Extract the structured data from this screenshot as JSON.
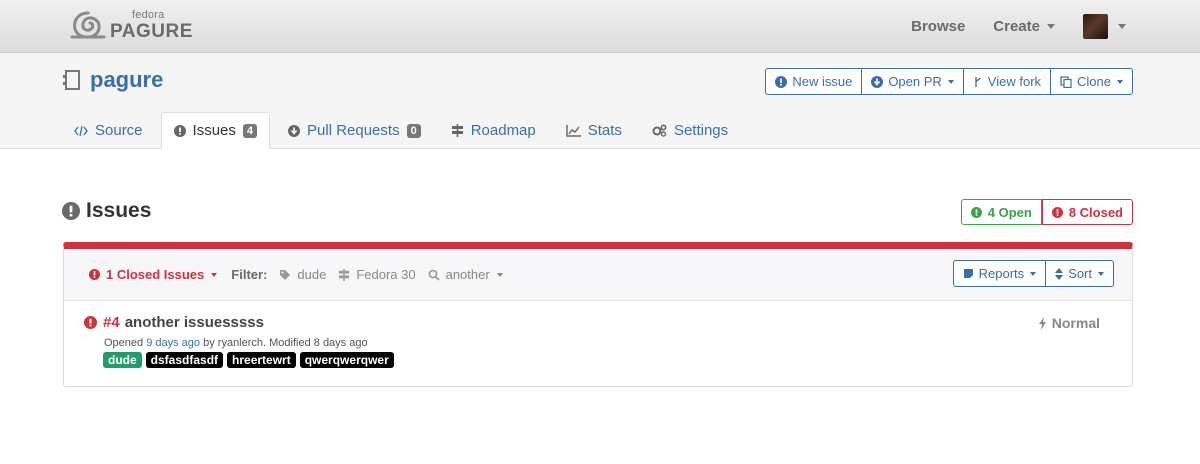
{
  "navbar": {
    "logo_small": "fedora",
    "logo_big": "PAGURE",
    "browse": "Browse",
    "create": "Create"
  },
  "repo": {
    "name": "pagure",
    "buttons": {
      "new_issue": "New issue",
      "open_pr": "Open PR",
      "view_fork": "View fork",
      "clone": "Clone"
    },
    "tabs": [
      {
        "label": "Source"
      },
      {
        "label": "Issues",
        "badge": "4"
      },
      {
        "label": "Pull Requests",
        "badge": "0"
      },
      {
        "label": "Roadmap"
      },
      {
        "label": "Stats"
      },
      {
        "label": "Settings"
      }
    ]
  },
  "issues": {
    "heading": "Issues",
    "open_label": "4 Open",
    "closed_label": "8 Closed",
    "filter_bar": {
      "closed_dropdown": "1 Closed Issues",
      "filter_label": "Filter:",
      "tag_filter": "dude",
      "milestone_filter": "Fedora 30",
      "search_filter": "another",
      "reports": "Reports",
      "sort": "Sort"
    },
    "list": [
      {
        "number": "#4",
        "title": "another issuesssss",
        "opened_prefix": "Opened",
        "opened_ago": "9 days ago",
        "by_text": "by ryanlerch. Modified 8 days ago",
        "priority": "Normal",
        "tags": [
          "dude",
          "dsfasdfasdf",
          "hreertewrt",
          "qwerqwerqwer"
        ]
      }
    ]
  },
  "colors": {
    "link": "#3a6ea8",
    "danger": "#d0323d",
    "success": "#3aa347",
    "tag_green": "#1f9d6c"
  }
}
